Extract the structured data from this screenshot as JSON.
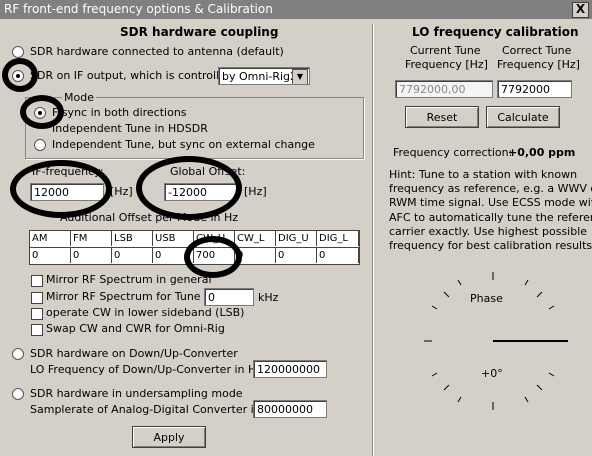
{
  "window": {
    "title": "RF front-end frequency options & Calibration",
    "close_label": "X"
  },
  "left": {
    "heading": "SDR hardware coupling",
    "radio_antenna": "SDR hardware connected to antenna (default)",
    "radio_if": "SDR on IF output, which is controlled",
    "control_select": "by Omni-Rig2",
    "mode_group": {
      "label": "Mode",
      "opt_sync_both": "F sync in both directions",
      "opt_independent": "Independent Tune in HDSDR",
      "opt_independent_sync": "Independent Tune, but sync on external change"
    },
    "if_frequency": {
      "label": "IF-frequency:",
      "value": "12000",
      "unit": "[Hz]"
    },
    "global_offset": {
      "label": "Global Offset:",
      "value": "-12000",
      "unit": "[Hz]"
    },
    "mode_offset_label": "Additional Offset per Mode in Hz",
    "mode_table": {
      "headers": [
        "AM",
        "FM",
        "LSB",
        "USB",
        "CW_U",
        "CW_L",
        "DIG_U",
        "DIG_L"
      ],
      "values": [
        "0",
        "0",
        "0",
        "0",
        "700",
        "0",
        "0",
        "0"
      ]
    },
    "mirror_general": "Mirror RF Spectrum in general",
    "mirror_tune": "Mirror RF Spectrum for Tune >=",
    "mirror_tune_value": "0",
    "mirror_tune_unit": "kHz",
    "operate_cw": "operate CW in lower sideband (LSB)",
    "swap_cw": "Swap CW and CWR for Omni-Rig",
    "radio_converter": "SDR hardware on Down/Up-Converter",
    "lo_converter_label": "LO Frequency of  Down/Up-Converter in Hz:",
    "lo_converter_value": "120000000",
    "radio_undersampling": "SDR hardware in undersampling mode",
    "samplerate_label": "Samplerate of Analog-Digital Converter in Hz:",
    "samplerate_value": "80000000",
    "apply_label": "Apply"
  },
  "right": {
    "heading": "LO frequency calibration",
    "current_label_1": "Current Tune",
    "current_label_2": "Frequency [Hz]",
    "correct_label_1": "Correct Tune",
    "correct_label_2": "Frequency [Hz]",
    "current_value": "7792000,00",
    "correct_value": "7792000",
    "reset_label": "Reset",
    "calculate_label": "Calculate",
    "correction_label": "Frequency correction:",
    "correction_value": "+0,00 ppm",
    "hint_lines": [
      "Hint: Tune to a station with known",
      "frequency as reference, e.g. a WWV or",
      "RWM time signal. Use ECSS mode with",
      "AFC to automatically tune the reference",
      "carrier exactly. Use highest possible",
      "frequency for best calibration results."
    ],
    "phase_label": "Phase",
    "phase_value": "+0°"
  }
}
